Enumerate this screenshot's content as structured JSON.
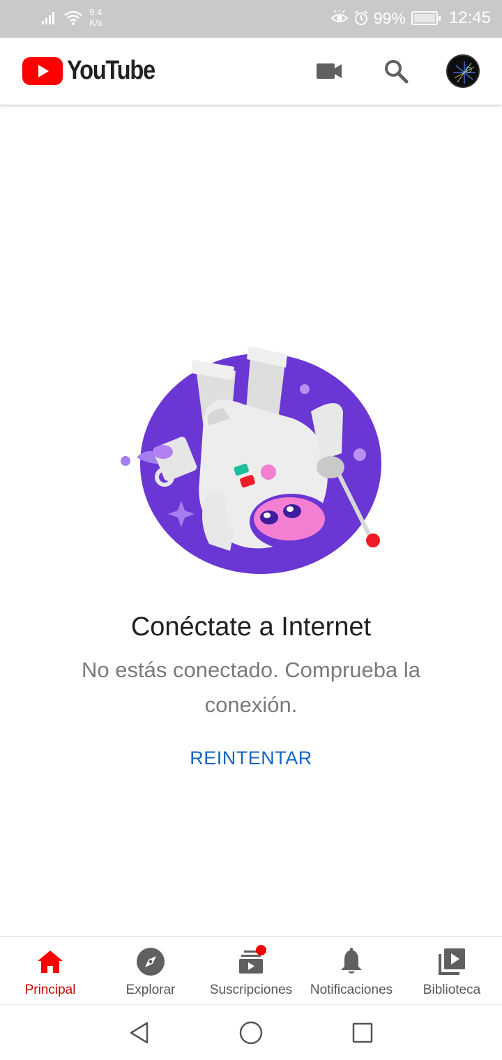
{
  "status_bar": {
    "net_speed_value": "9.4",
    "net_speed_unit": "K/s",
    "battery": "99%",
    "time": "12:45",
    "icons": [
      "signal-icon",
      "wifi-icon",
      "eye-comfort-icon",
      "alarm-icon",
      "battery-icon"
    ]
  },
  "app_bar": {
    "logo_text": "YouTube",
    "brand_color": "#ff0000",
    "icons": [
      "camera-icon",
      "search-icon",
      "avatar"
    ]
  },
  "error": {
    "title": "Conéctate a Internet",
    "message": "No estás conectado. Comprueba la conexión.",
    "retry_label": "REINTENTAR",
    "retry_color": "#1565c0",
    "illustration": "astronaut-cow-illustration"
  },
  "bottom_nav": {
    "items": [
      {
        "label": "Principal",
        "icon": "home-icon",
        "active": true
      },
      {
        "label": "Explorar",
        "icon": "explore-icon",
        "active": false
      },
      {
        "label": "Suscripciones",
        "icon": "subscriptions-icon",
        "active": false,
        "badge": true
      },
      {
        "label": "Notificaciones",
        "icon": "bell-icon",
        "active": false
      },
      {
        "label": "Biblioteca",
        "icon": "library-icon",
        "active": false
      }
    ]
  },
  "system_nav": {
    "icons": [
      "back-icon",
      "home-circle-icon",
      "recents-icon"
    ]
  }
}
